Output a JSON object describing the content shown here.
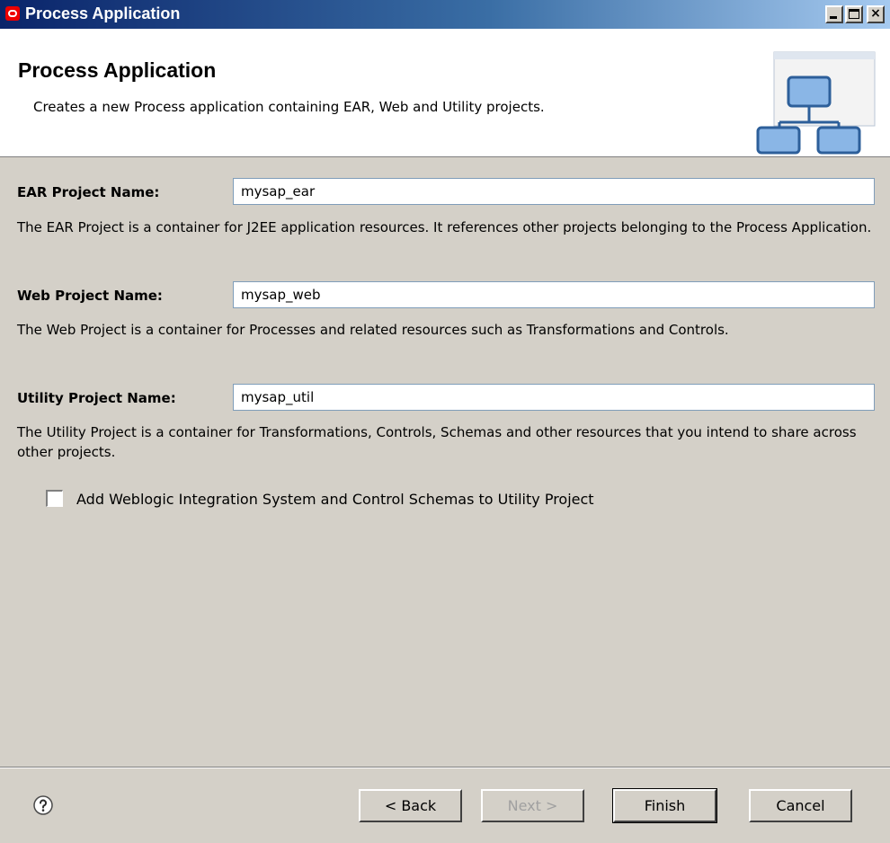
{
  "window": {
    "title": "Process Application",
    "controls": {
      "minimize": "_",
      "maximize": "□",
      "close": "×"
    }
  },
  "header": {
    "title": "Process Application",
    "description": "Creates a new Process application containing EAR, Web and Utility projects."
  },
  "form": {
    "ear": {
      "label": "EAR Project Name:",
      "value": "mysap_ear",
      "help": "The EAR Project is a container for J2EE application resources.  It references other projects belonging to the Process Application."
    },
    "web": {
      "label": "Web Project Name:",
      "value": "mysap_web",
      "help": "The Web Project is a container for Processes and related resources such as Transformations and Controls."
    },
    "utility": {
      "label": "Utility Project Name:",
      "value": "mysap_util",
      "help": "The Utility Project is a container for Transformations, Controls, Schemas and other resources that you intend to share across other projects."
    },
    "add_schemas": {
      "label": "Add Weblogic Integration System and Control Schemas to Utility Project",
      "checked": false
    }
  },
  "footer": {
    "help_icon": "help-icon",
    "back_label": "< Back",
    "next_label": "Next >",
    "finish_label": "Finish",
    "cancel_label": "Cancel"
  }
}
